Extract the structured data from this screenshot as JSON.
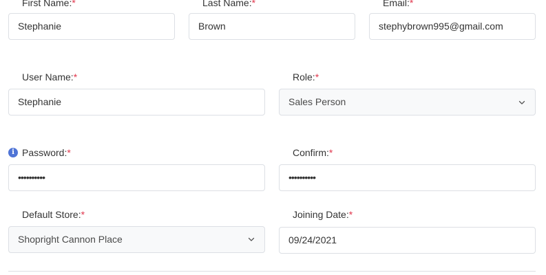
{
  "form": {
    "first_name": {
      "label": "First Name:",
      "required": "*",
      "value": "Stephanie"
    },
    "last_name": {
      "label": "Last Name:",
      "required": "*",
      "value": "Brown"
    },
    "email": {
      "label": "Email:",
      "required": "*",
      "value": "stephybrown995@gmail.com"
    },
    "user_name": {
      "label": "User Name:",
      "required": "*",
      "value": "Stephanie"
    },
    "role": {
      "label": "Role:",
      "required": "*",
      "value": "Sales Person"
    },
    "password": {
      "label": "Password:",
      "required": "*",
      "value": "••••••••••"
    },
    "confirm": {
      "label": "Confirm:",
      "required": "*",
      "value": "••••••••••"
    },
    "default_store": {
      "label": "Default Store:",
      "required": "*",
      "value": "Shopright Cannon Place"
    },
    "joining_date": {
      "label": "Joining Date:",
      "required": "*",
      "value": "09/24/2021"
    }
  },
  "icons": {
    "password_info": "info-icon",
    "dropdown": "chevron-down-icon"
  },
  "colors": {
    "required": "#e0364c",
    "info_icon": "#4f74d6",
    "border": "#dcdfe4"
  }
}
